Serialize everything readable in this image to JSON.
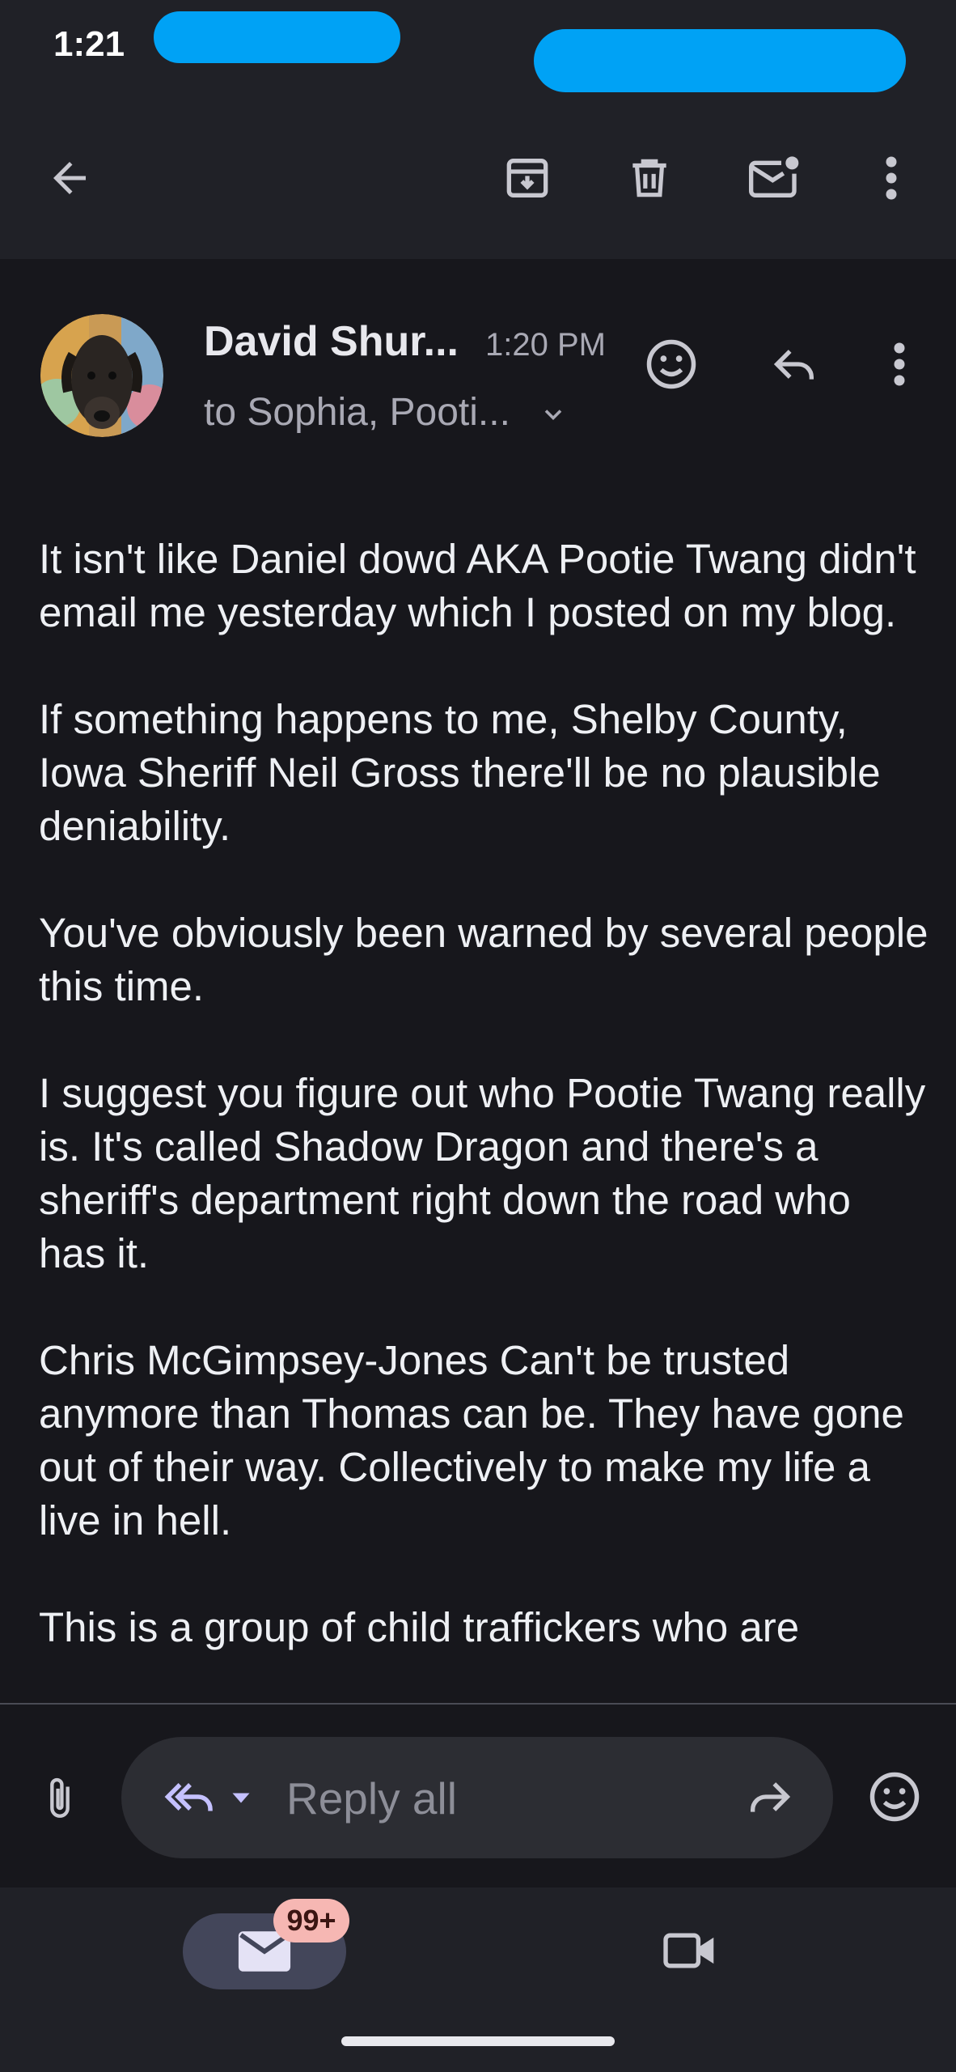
{
  "status_bar": {
    "time": "1:21"
  },
  "toolbar": {
    "back_icon": "arrow-left-icon",
    "archive_icon": "archive-icon",
    "delete_icon": "trash-icon",
    "mark_unread_icon": "mail-unread-icon",
    "more_icon": "more-vert-icon"
  },
  "message": {
    "sender": "David Shur...",
    "time": "1:20 PM",
    "recipients": "to Sophia, Pooti...",
    "body": [
      "It isn't like Daniel dowd AKA Pootie Twang didn't email me yesterday which I posted on my blog.",
      "If something happens to me, Shelby County, Iowa Sheriff Neil Gross there'll be no plausible deniability.",
      "You've obviously been warned by several people this time.",
      "I suggest you figure out who Pootie Twang really is. It's called Shadow Dragon and there's a sheriff's department right down the road who has it.",
      "Chris McGimpsey-Jones Can't be trusted anymore than Thomas can be. They have gone out of their way. Collectively to make my life a live in hell.",
      "This is a group of child traffickers who are"
    ]
  },
  "reply": {
    "placeholder": "Reply all"
  },
  "bottom_nav": {
    "mail_badge": "99+"
  },
  "colors": {
    "background": "#17171c",
    "bar": "#202127",
    "accent": "#c5c1ff",
    "badge": "#f6b7b3"
  }
}
